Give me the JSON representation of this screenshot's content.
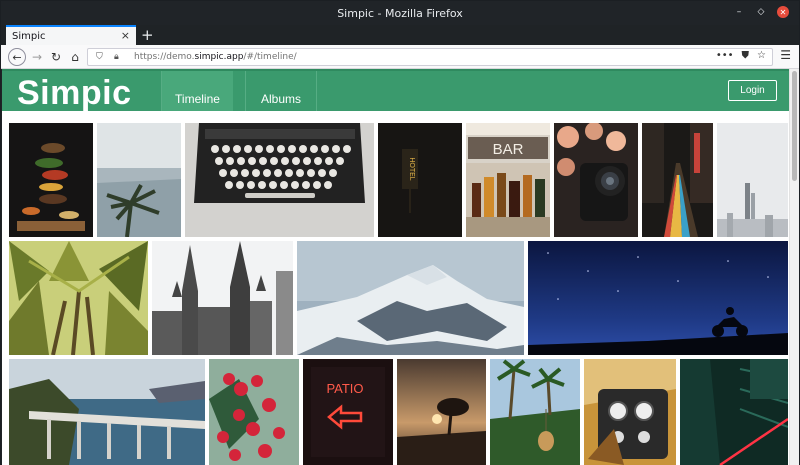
{
  "window": {
    "title": "Simpic - Mozilla Firefox"
  },
  "tabs": [
    {
      "label": "Simpic"
    }
  ],
  "urlbar": {
    "prefix": "https://demo.",
    "host": "simpic.app",
    "suffix": "/#/timeline/"
  },
  "app": {
    "logo": "Simpic",
    "nav": [
      {
        "label": "Timeline",
        "active": true
      },
      {
        "label": "Albums",
        "active": false
      }
    ],
    "login_label": "Login",
    "accent": "#3a9a6d"
  },
  "photos": [
    {
      "subject": "burger-ingredients",
      "text": ""
    },
    {
      "subject": "sea-palm",
      "text": ""
    },
    {
      "subject": "typewriter",
      "text": ""
    },
    {
      "subject": "hotel-sign",
      "text": "HOTEL"
    },
    {
      "subject": "bar-bottles",
      "text": "BAR"
    },
    {
      "subject": "camera-flowers",
      "text": ""
    },
    {
      "subject": "street-night",
      "text": ""
    },
    {
      "subject": "foggy-city",
      "text": ""
    },
    {
      "subject": "palm-trees",
      "text": ""
    },
    {
      "subject": "cathedral-spires",
      "text": ""
    },
    {
      "subject": "snowy-mountain",
      "text": ""
    },
    {
      "subject": "motorcycle-night",
      "text": ""
    },
    {
      "subject": "coastal-bridge",
      "text": ""
    },
    {
      "subject": "red-berries",
      "text": ""
    },
    {
      "subject": "patio-neon-sign",
      "text": "PATIO"
    },
    {
      "subject": "sunset-tree",
      "text": ""
    },
    {
      "subject": "palms-swing",
      "text": ""
    },
    {
      "subject": "car-dashboard",
      "text": ""
    },
    {
      "subject": "neon-lines",
      "text": ""
    }
  ]
}
